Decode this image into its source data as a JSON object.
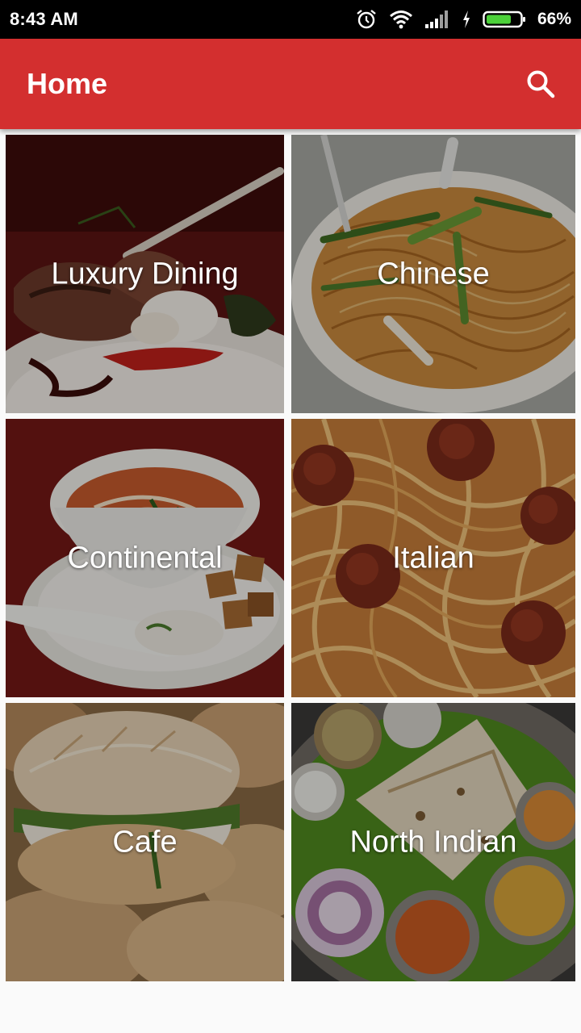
{
  "status_bar": {
    "time": "8:43 AM",
    "battery": "66%",
    "icons": [
      "alarm-icon",
      "wifi-icon",
      "signal-icon",
      "charging-icon",
      "battery-icon"
    ]
  },
  "app_bar": {
    "title": "Home",
    "search_icon": "search-icon",
    "color": "#d32f2f"
  },
  "categories": [
    {
      "label": "Luxury Dining"
    },
    {
      "label": "Chinese"
    },
    {
      "label": "Continental"
    },
    {
      "label": "Italian"
    },
    {
      "label": "Cafe"
    },
    {
      "label": "North Indian"
    }
  ]
}
